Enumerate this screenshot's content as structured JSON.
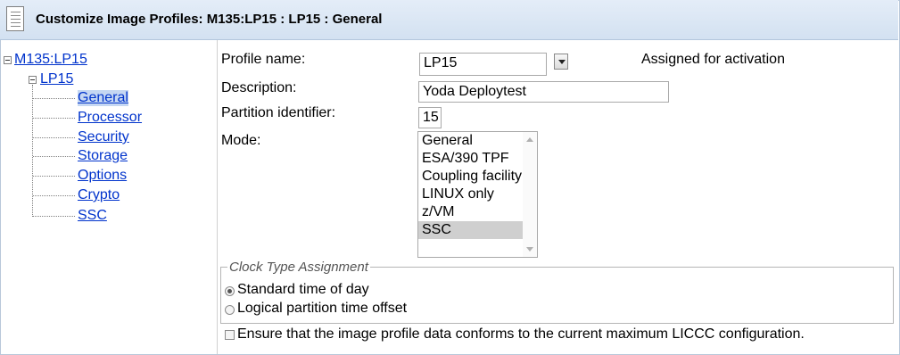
{
  "window": {
    "title": "Customize Image Profiles: M135:LP15 : LP15 : General",
    "icon": "document-list-icon"
  },
  "tree": {
    "root": {
      "label": "M135:LP15"
    },
    "child": {
      "label": "LP15"
    },
    "items": [
      {
        "label": "General",
        "selected": true
      },
      {
        "label": "Processor"
      },
      {
        "label": "Security"
      },
      {
        "label": "Storage"
      },
      {
        "label": "Options"
      },
      {
        "label": "Crypto"
      },
      {
        "label": "SSC"
      }
    ]
  },
  "form": {
    "profile_name": {
      "label": "Profile name:",
      "value": "LP15",
      "status": "Assigned for activation"
    },
    "description": {
      "label": "Description:",
      "value": "Yoda Deploytest"
    },
    "partition_identifier": {
      "label": "Partition identifier:",
      "value": "15"
    },
    "mode": {
      "label": "Mode:",
      "options": [
        "General",
        "ESA/390 TPF",
        "Coupling facility",
        "LINUX only",
        "z/VM",
        "SSC"
      ],
      "selected": "SSC"
    },
    "clock": {
      "legend": "Clock Type Assignment",
      "options": [
        {
          "label": "Standard time of day",
          "checked": true
        },
        {
          "label": "Logical partition time offset",
          "checked": false
        }
      ]
    },
    "licc": {
      "label": "Ensure that the image profile data conforms to the current maximum LICCC configuration.",
      "checked": false
    }
  }
}
